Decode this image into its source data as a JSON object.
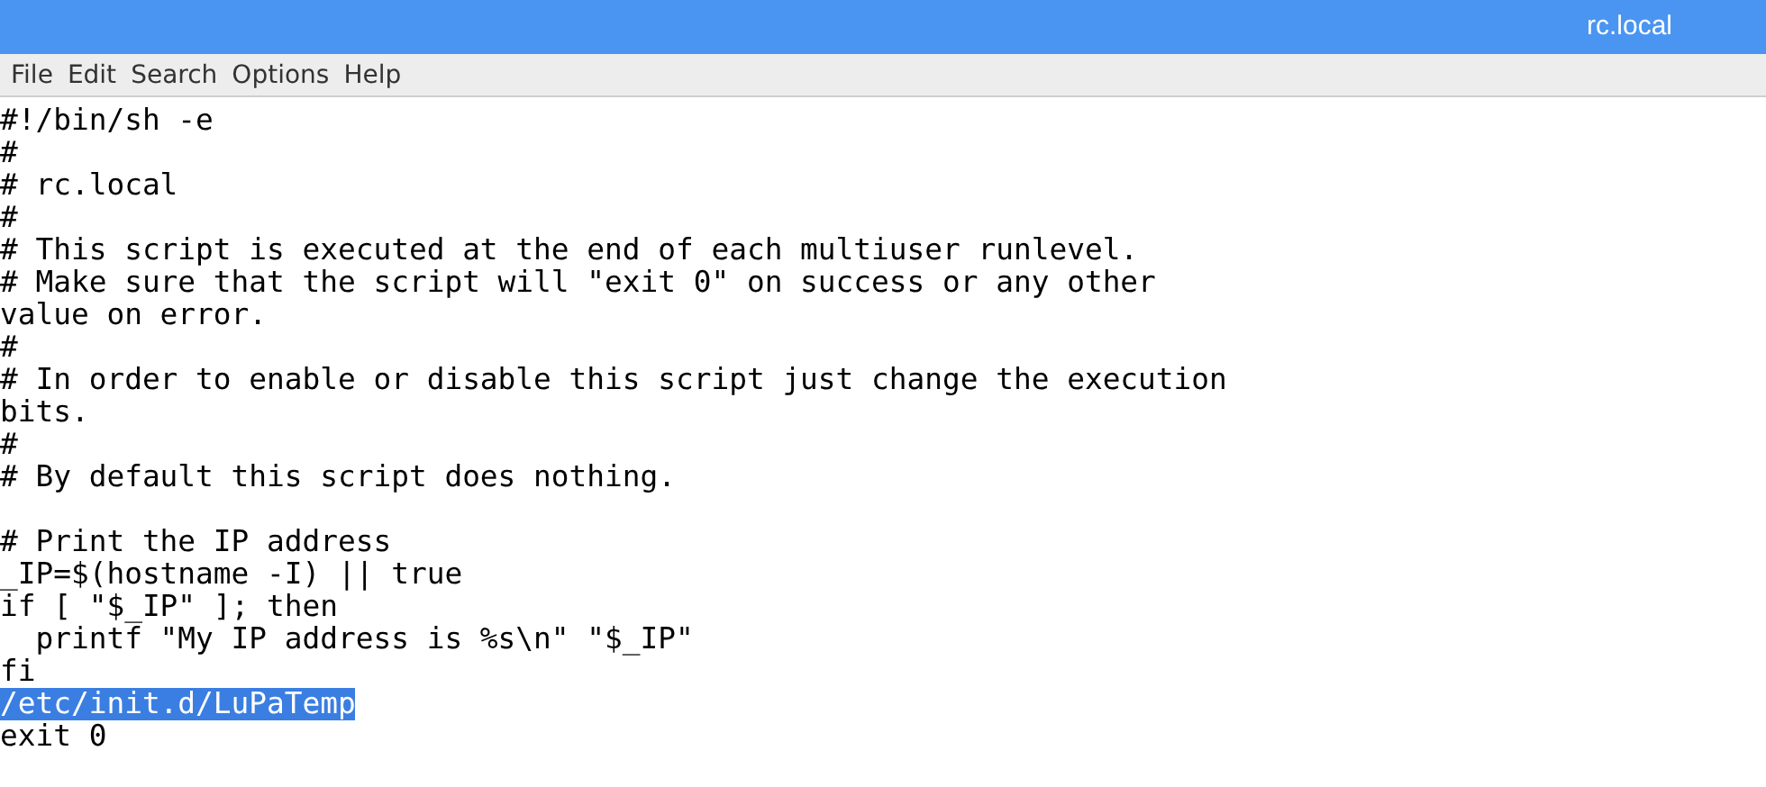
{
  "window": {
    "title": "rc.local"
  },
  "menu": [
    "File",
    "Edit",
    "Search",
    "Options",
    "Help"
  ],
  "editor": {
    "lines": [
      {
        "kind": "code",
        "text": "#!/bin/sh -e",
        "selected": false
      },
      {
        "kind": "code",
        "text": "#",
        "selected": false
      },
      {
        "kind": "code",
        "text": "# rc.local",
        "selected": false
      },
      {
        "kind": "code",
        "text": "#",
        "selected": false
      },
      {
        "kind": "code",
        "text": "# This script is executed at the end of each multiuser runlevel.",
        "selected": false
      },
      {
        "kind": "code",
        "text": "# Make sure that the script will \"exit 0\" on success or any other",
        "selected": false
      },
      {
        "kind": "code",
        "text": "value on error.",
        "selected": false
      },
      {
        "kind": "code",
        "text": "#",
        "selected": false
      },
      {
        "kind": "code",
        "text": "# In order to enable or disable this script just change the execution",
        "selected": false
      },
      {
        "kind": "code",
        "text": "bits.",
        "selected": false
      },
      {
        "kind": "code",
        "text": "#",
        "selected": false
      },
      {
        "kind": "code",
        "text": "# By default this script does nothing.",
        "selected": false
      },
      {
        "kind": "blank"
      },
      {
        "kind": "code",
        "text": "# Print the IP address",
        "selected": false
      },
      {
        "kind": "code",
        "text": "_IP=$(hostname -I) || true",
        "selected": false
      },
      {
        "kind": "code",
        "text": "if [ \"$_IP\" ]; then",
        "selected": false
      },
      {
        "kind": "code",
        "text": "  printf \"My IP address is %s\\n\" \"$_IP\"",
        "selected": false
      },
      {
        "kind": "code",
        "text": "fi",
        "selected": false
      },
      {
        "kind": "code",
        "text": "/etc/init.d/LuPaTemp",
        "selected": true
      },
      {
        "kind": "code",
        "text": "exit 0",
        "selected": false
      }
    ]
  }
}
